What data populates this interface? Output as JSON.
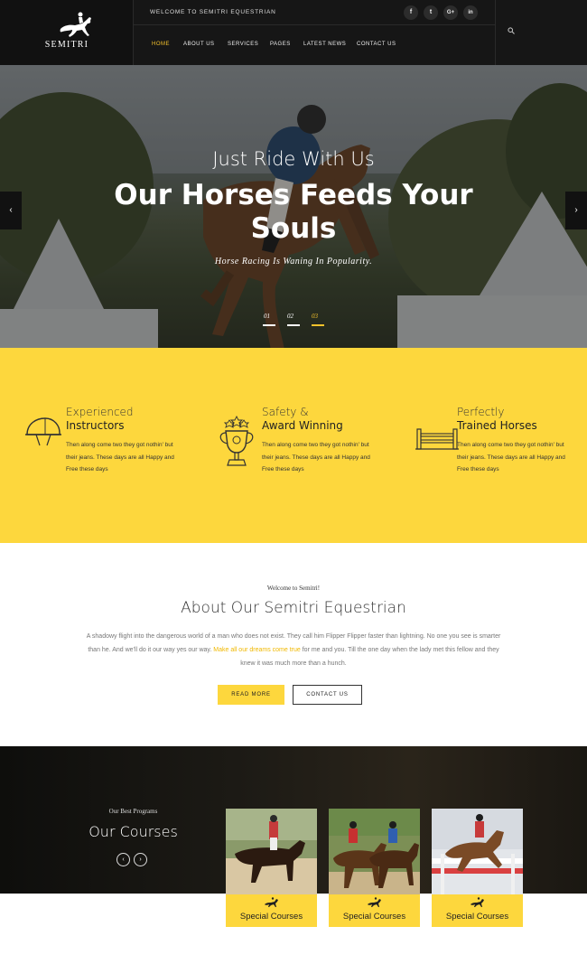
{
  "brand": {
    "name": "SEMITRI"
  },
  "topbar": {
    "welcome": "WELCOME TO SEMITRI EQUESTRIAN"
  },
  "social": [
    {
      "name": "facebook-icon",
      "glyph": "f"
    },
    {
      "name": "twitter-icon",
      "glyph": "t"
    },
    {
      "name": "google-plus-icon",
      "glyph": "G+"
    },
    {
      "name": "linkedin-icon",
      "glyph": "in"
    }
  ],
  "nav": {
    "items": [
      {
        "label": "HOME",
        "active": true
      },
      {
        "label": "ABOUT US"
      },
      {
        "label": "SERVICES"
      },
      {
        "label": "PAGES"
      },
      {
        "label": "LATEST NEWS"
      },
      {
        "label": "CONTACT US"
      }
    ]
  },
  "hero": {
    "subtitle": "Just Ride With Us",
    "title": "Our Horses Feeds Your Souls",
    "tagline": "Horse Racing Is Waning In Popularity.",
    "slides": [
      "01",
      "02",
      "03"
    ],
    "active_slide": "03",
    "prev": "‹",
    "next": "›"
  },
  "features": [
    {
      "title1": "Experienced",
      "title2": "Instructors",
      "icon": "helmet-icon",
      "text": "Then along come two they got nothin' but their jeans. These days are all Happy and Free these days"
    },
    {
      "title1": "Safety &",
      "title2": "Award Winning",
      "icon": "trophy-icon",
      "text": "Then along come two they got nothin' but their jeans. These days are all Happy and Free these days"
    },
    {
      "title1": "Perfectly",
      "title2": "Trained Horses",
      "icon": "fence-icon",
      "text": "Then along come two they got nothin' but their jeans. These days are all Happy and Free these days"
    }
  ],
  "about": {
    "kicker": "Welcome to Semitri!",
    "title": "About Our Semitri Equestrian",
    "text_before": "A shadowy flight into the dangerous world of a man who does not exist. They call him Flipper Flipper faster than lightning. No one you see is smarter than he. And we'll do it our way yes our way. ",
    "text_highlight": "Make all our dreams come true",
    "text_after": " for me and you. Till the one day when the lady met this fellow and they knew it was much more than a hunch.",
    "read_more": "READ MORE",
    "contact": "CONTACT US"
  },
  "courses": {
    "kicker": "Our Best Programs",
    "title": "Our Courses",
    "prev": "‹",
    "next": "›",
    "cards": [
      {
        "label": "Special Courses"
      },
      {
        "label": "Special Courses"
      },
      {
        "label": "Special Courses"
      }
    ]
  },
  "colors": {
    "accent": "#fdd73d",
    "header": "#161616",
    "nav_active": "#f5c22c"
  }
}
